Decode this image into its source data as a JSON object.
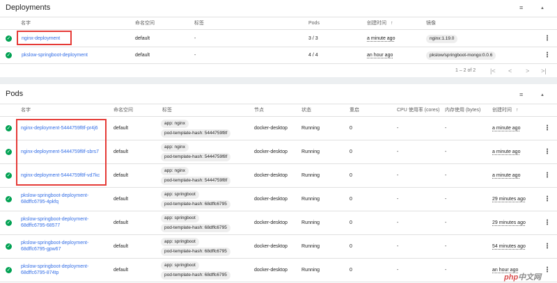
{
  "deployments": {
    "title": "Deployments",
    "headers": [
      "名字",
      "命名空间",
      "标签",
      "Pods",
      "创建时间",
      "镜像"
    ],
    "sort_arrow": "↑",
    "rows": [
      {
        "name": "nginx-deployment",
        "namespace": "default",
        "labels": "-",
        "pods": "3 / 3",
        "created": "a minute ago",
        "image": "nginx:1.19.0"
      },
      {
        "name": "pkslow-springboot-deployment",
        "namespace": "default",
        "labels": "-",
        "pods": "4 / 4",
        "created": "an hour ago",
        "image": "pkslow/springboot-mongo:0.0.6"
      }
    ],
    "pagination": "1 – 2 of 2"
  },
  "pods": {
    "title": "Pods",
    "headers": [
      "名字",
      "命名空间",
      "标签",
      "节点",
      "状态",
      "重启",
      "CPU 使用率 (cores)",
      "内存使用 (bytes)",
      "创建时间"
    ],
    "sort_arrow": "↑",
    "rows": [
      {
        "name": [
          "nginx-deployment-5444759f8f-pr4j6"
        ],
        "namespace": "default",
        "labels": [
          "app: nginx",
          "pod-template-hash: 5444759f8f"
        ],
        "node": "docker-desktop",
        "status": "Running",
        "restarts": "0",
        "cpu": "-",
        "mem": "-",
        "created": "a minute ago"
      },
      {
        "name": [
          "nginx-deployment-5444759f8f-sbrs7"
        ],
        "namespace": "default",
        "labels": [
          "app: nginx",
          "pod-template-hash: 5444759f8f"
        ],
        "node": "docker-desktop",
        "status": "Running",
        "restarts": "0",
        "cpu": "-",
        "mem": "-",
        "created": "a minute ago"
      },
      {
        "name": [
          "nginx-deployment-5444759f8f-vd7kc"
        ],
        "namespace": "default",
        "labels": [
          "app: nginx",
          "pod-template-hash: 5444759f8f"
        ],
        "node": "docker-desktop",
        "status": "Running",
        "restarts": "0",
        "cpu": "-",
        "mem": "-",
        "created": "a minute ago"
      },
      {
        "name": [
          "pkslow-springboot-deployment-",
          "68dffc6795-4pkfq"
        ],
        "namespace": "default",
        "labels": [
          "app: springboot",
          "pod-template-hash: 68dffc6795"
        ],
        "node": "docker-desktop",
        "status": "Running",
        "restarts": "0",
        "cpu": "-",
        "mem": "-",
        "created": "29 minutes ago"
      },
      {
        "name": [
          "pkslow-springboot-deployment-",
          "68dffc6795-68577"
        ],
        "namespace": "default",
        "labels": [
          "app: springboot",
          "pod-template-hash: 68dffc6795"
        ],
        "node": "docker-desktop",
        "status": "Running",
        "restarts": "0",
        "cpu": "-",
        "mem": "-",
        "created": "29 minutes ago"
      },
      {
        "name": [
          "pkslow-springboot-deployment-",
          "68dffc6795-gpw67"
        ],
        "namespace": "default",
        "labels": [
          "app: springboot",
          "pod-template-hash: 68dffc6795"
        ],
        "node": "docker-desktop",
        "status": "Running",
        "restarts": "0",
        "cpu": "-",
        "mem": "-",
        "created": "54 minutes ago"
      },
      {
        "name": [
          "pkslow-springboot-deployment-",
          "68dffc6795-874tp"
        ],
        "namespace": "default",
        "labels": [
          "app: springboot",
          "pod-template-hash: 68dffc6795"
        ],
        "node": "docker-desktop",
        "status": "Running",
        "restarts": "0",
        "cpu": "-",
        "mem": "-",
        "created": "an hour ago"
      }
    ]
  },
  "icons": {
    "filter": "filter-icon",
    "collapse": "caret-up-icon",
    "more": "kebab-menu-icon",
    "status_ok": "check-circle-icon",
    "first_page": "first-page-icon",
    "prev_page": "chevron-left-icon",
    "next_page": "chevron-right-icon",
    "last_page": "last-page-icon"
  },
  "glyphs": {
    "check": "✓",
    "kebab": "⋮",
    "caret": "▲",
    "filter": "≡",
    "first": "|<",
    "prev": "<",
    "next": ">",
    "last": ">|"
  },
  "colors": {
    "link": "#326de6",
    "ok": "#00a152",
    "highlight": "#e53935",
    "chip": "#eeeeee"
  },
  "watermark": {
    "text1": "php",
    "text2": "中文网"
  }
}
